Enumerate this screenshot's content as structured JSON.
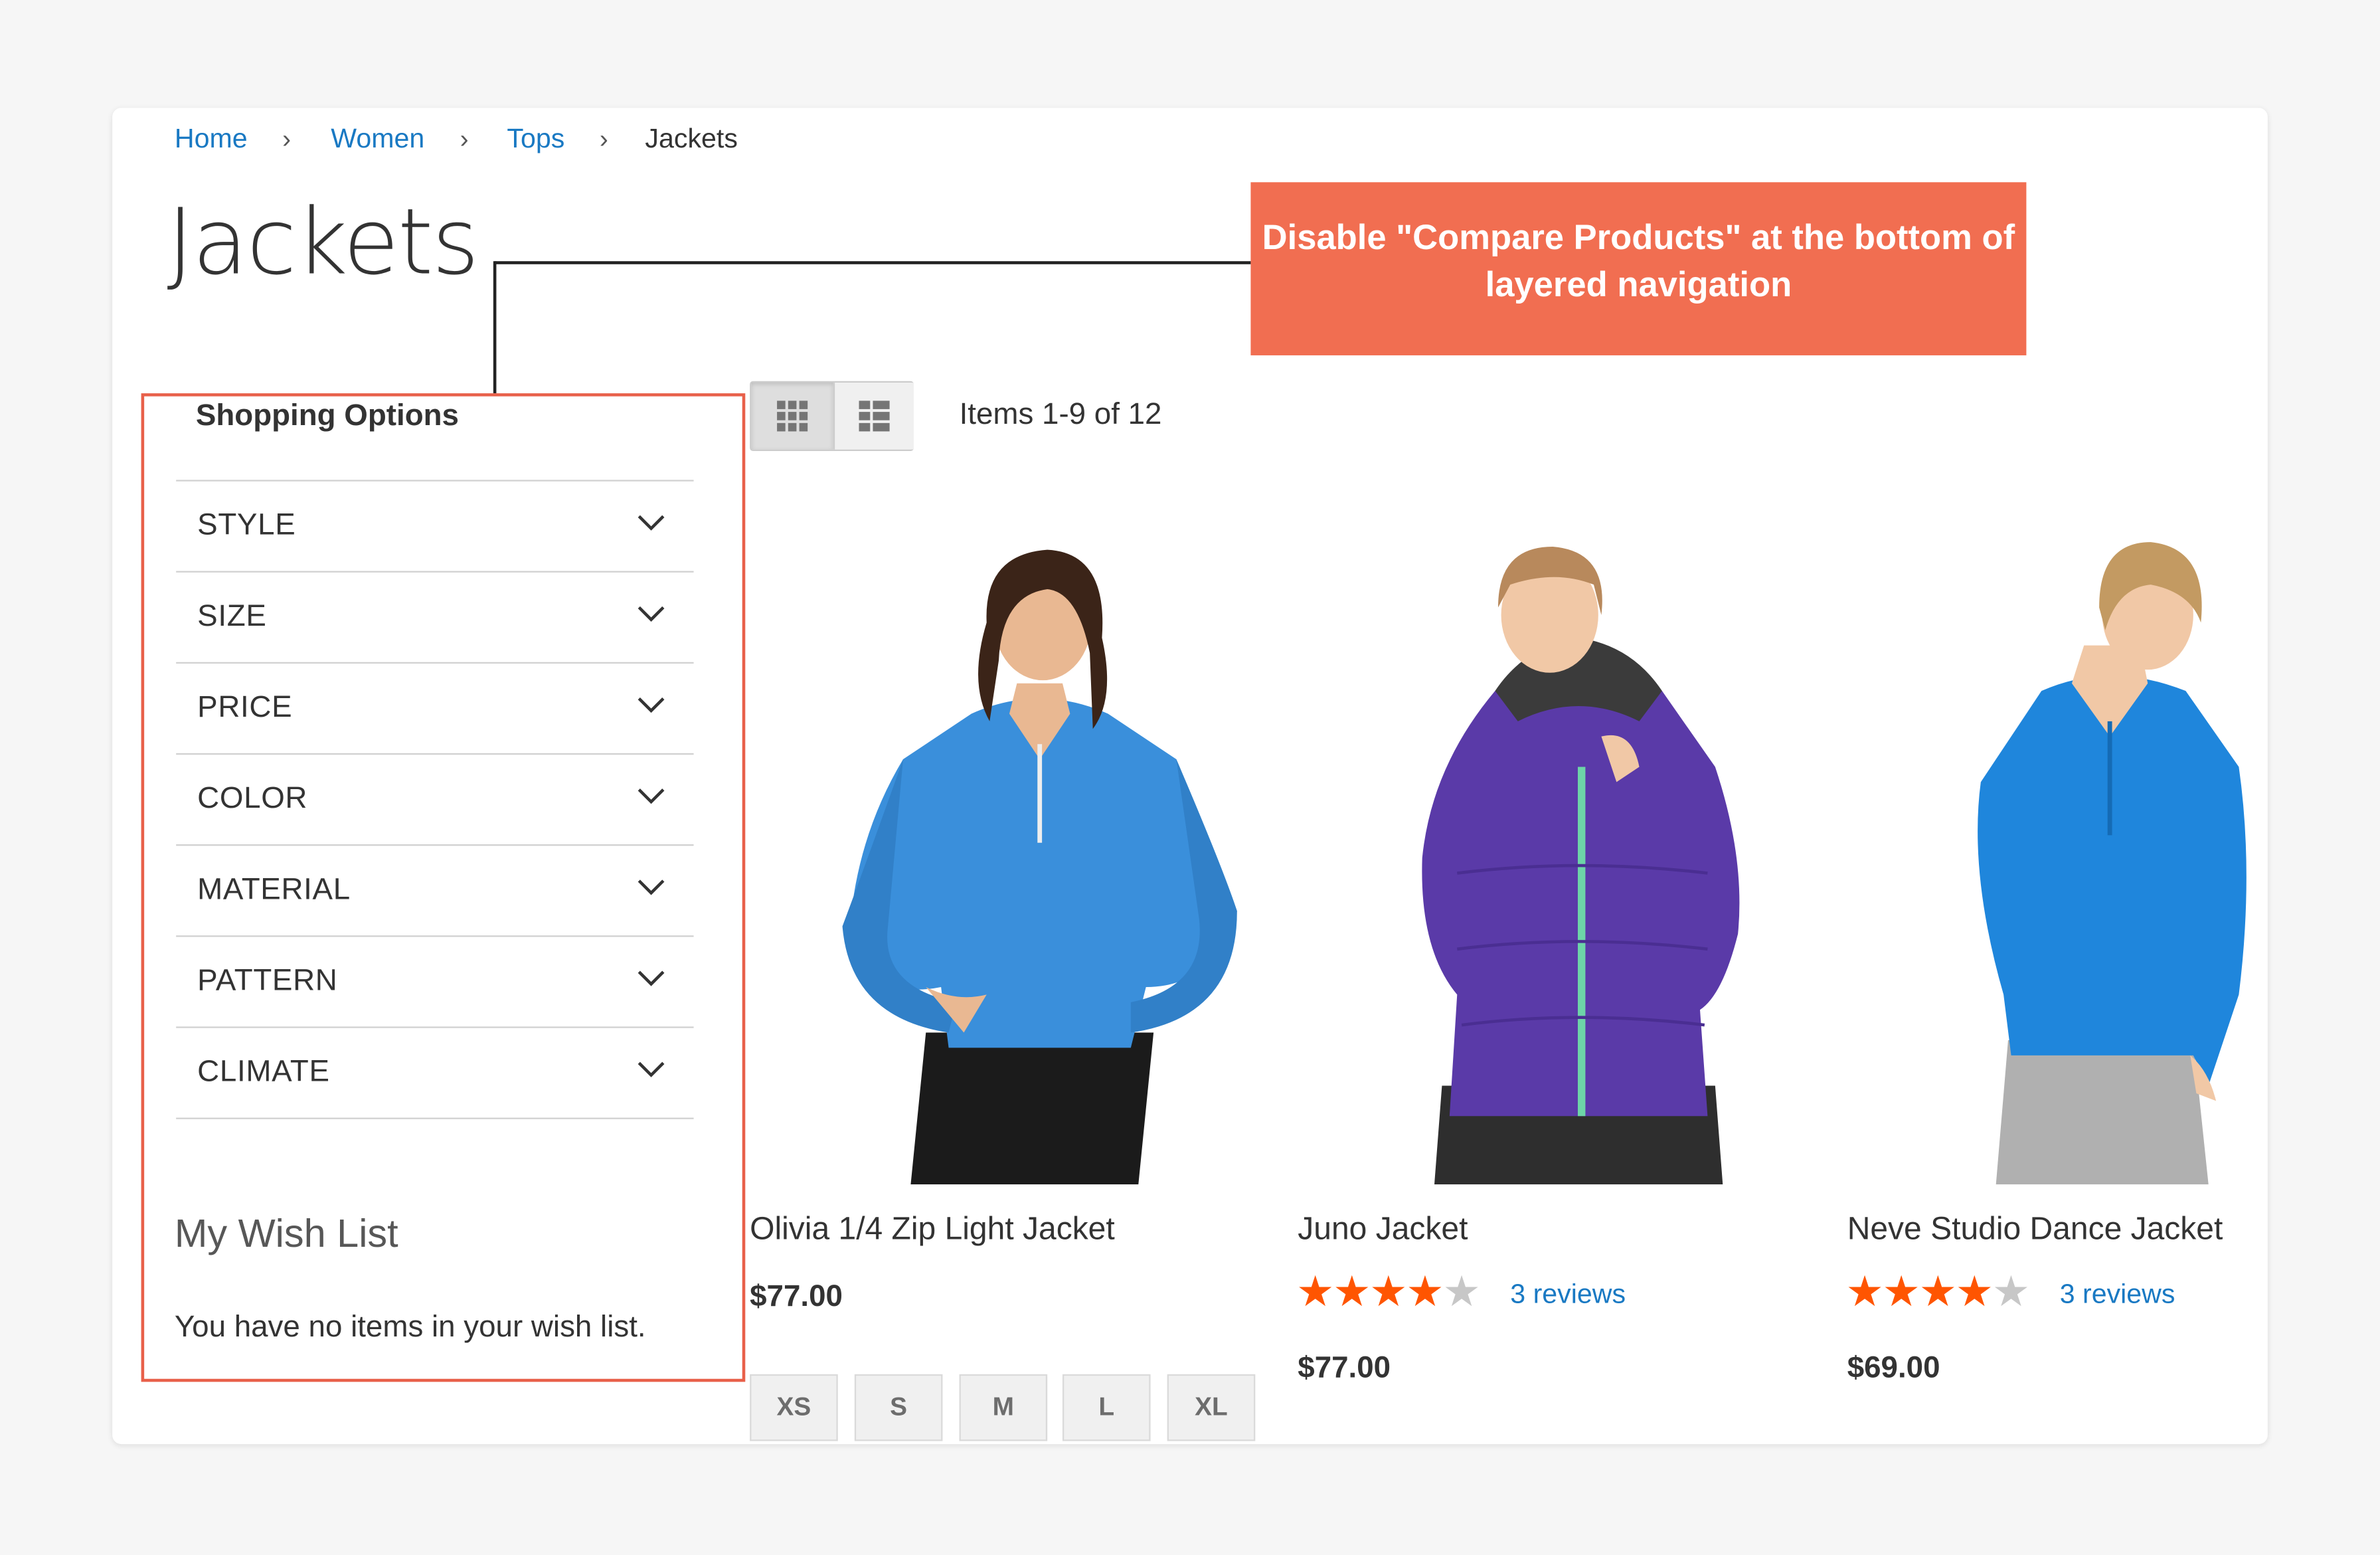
{
  "breadcrumbs": [
    {
      "label": "Home"
    },
    {
      "label": "Women"
    },
    {
      "label": "Tops"
    },
    {
      "label": "Jackets"
    }
  ],
  "page_title": "Jackets",
  "callout": {
    "text": "Disable \"Compare Products\" at the bottom of layered navigation"
  },
  "sidebar": {
    "title": "Shopping Options",
    "filters": [
      {
        "label": "STYLE"
      },
      {
        "label": "SIZE"
      },
      {
        "label": "PRICE"
      },
      {
        "label": "COLOR"
      },
      {
        "label": "MATERIAL"
      },
      {
        "label": "PATTERN"
      },
      {
        "label": "CLIMATE"
      }
    ],
    "wishlist": {
      "title": "My Wish List",
      "empty_text": "You have no items in your wish list."
    }
  },
  "toolbar": {
    "amount": "Items 1-9 of 12",
    "modes": [
      {
        "icon": "grid-icon",
        "active": true
      },
      {
        "icon": "list-icon",
        "active": false
      }
    ]
  },
  "products": [
    {
      "name": "Olivia 1/4 Zip Light Jacket",
      "price": "$77.00",
      "sizes": [
        "XS",
        "S",
        "M",
        "L",
        "XL"
      ],
      "color": "#3a8fdb"
    },
    {
      "name": "Juno Jacket",
      "rating": 4.5,
      "reviews": "3 reviews",
      "price": "$77.00",
      "color": "#5a3aa8"
    },
    {
      "name": "Neve Studio Dance Jacket",
      "rating": 4.5,
      "reviews": "3 reviews",
      "price": "$69.00",
      "color": "#1f86dc"
    }
  ],
  "colors": {
    "link": "#1979c3",
    "callout": "#f16e51",
    "highlight": "#e8604a",
    "star": "#ff5501"
  }
}
